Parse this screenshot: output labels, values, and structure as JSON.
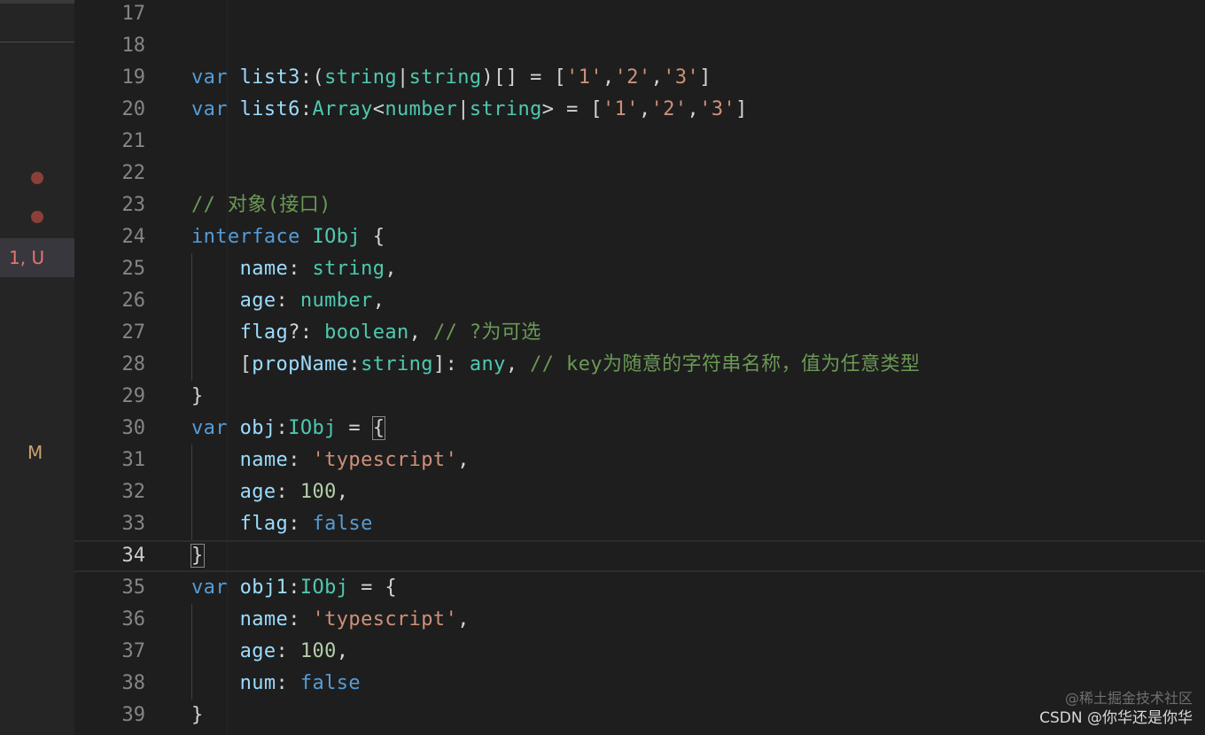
{
  "sidebar": {
    "status_error": "1, U",
    "status_modified": "M",
    "colors": {
      "error": "#e8736b",
      "modified": "#c9a26d",
      "dot": "#8a4038"
    }
  },
  "editor": {
    "lines": [
      {
        "n": "17",
        "tokens": []
      },
      {
        "n": "18",
        "tokens": []
      },
      {
        "n": "19",
        "tokens": [
          [
            "kw",
            "var"
          ],
          [
            "pun",
            " "
          ],
          [
            "var",
            "list3"
          ],
          [
            "pun",
            ":("
          ],
          [
            "type",
            "string"
          ],
          [
            "pun",
            "|"
          ],
          [
            "type",
            "string"
          ],
          [
            "pun",
            ")[] = ["
          ],
          [
            "str",
            "'1'"
          ],
          [
            "pun",
            ","
          ],
          [
            "str",
            "'2'"
          ],
          [
            "pun",
            ","
          ],
          [
            "str",
            "'3'"
          ],
          [
            "pun",
            "]"
          ]
        ]
      },
      {
        "n": "20",
        "tokens": [
          [
            "kw",
            "var"
          ],
          [
            "pun",
            " "
          ],
          [
            "var",
            "list6"
          ],
          [
            "pun",
            ":"
          ],
          [
            "type",
            "Array"
          ],
          [
            "pun",
            "<"
          ],
          [
            "type",
            "number"
          ],
          [
            "pun",
            "|"
          ],
          [
            "type",
            "string"
          ],
          [
            "pun",
            "> = ["
          ],
          [
            "str",
            "'1'"
          ],
          [
            "pun",
            ","
          ],
          [
            "str",
            "'2'"
          ],
          [
            "pun",
            ","
          ],
          [
            "str",
            "'3'"
          ],
          [
            "pun",
            "]"
          ]
        ]
      },
      {
        "n": "21",
        "tokens": []
      },
      {
        "n": "22",
        "tokens": []
      },
      {
        "n": "23",
        "tokens": [
          [
            "com",
            "// 对象(接口)"
          ]
        ]
      },
      {
        "n": "24",
        "tokens": [
          [
            "kw",
            "interface"
          ],
          [
            "pun",
            " "
          ],
          [
            "type",
            "IObj"
          ],
          [
            "pun",
            " {"
          ]
        ]
      },
      {
        "n": "25",
        "tokens": [
          [
            "pun",
            "    "
          ],
          [
            "prop",
            "name"
          ],
          [
            "pun",
            ": "
          ],
          [
            "type",
            "string"
          ],
          [
            "pun",
            ","
          ]
        ]
      },
      {
        "n": "26",
        "tokens": [
          [
            "pun",
            "    "
          ],
          [
            "prop",
            "age"
          ],
          [
            "pun",
            ": "
          ],
          [
            "type",
            "number"
          ],
          [
            "pun",
            ","
          ]
        ]
      },
      {
        "n": "27",
        "tokens": [
          [
            "pun",
            "    "
          ],
          [
            "prop",
            "flag"
          ],
          [
            "pun",
            "?: "
          ],
          [
            "type",
            "boolean"
          ],
          [
            "pun",
            ", "
          ],
          [
            "com",
            "// ?为可选"
          ]
        ]
      },
      {
        "n": "28",
        "tokens": [
          [
            "pun",
            "    ["
          ],
          [
            "prop",
            "propName"
          ],
          [
            "pun",
            ":"
          ],
          [
            "type",
            "string"
          ],
          [
            "pun",
            "]: "
          ],
          [
            "type",
            "any"
          ],
          [
            "pun",
            ", "
          ],
          [
            "com",
            "// key为随意的字符串名称，值为任意类型"
          ]
        ]
      },
      {
        "n": "29",
        "tokens": [
          [
            "pun",
            "}"
          ]
        ]
      },
      {
        "n": "30",
        "tokens": [
          [
            "kw",
            "var"
          ],
          [
            "pun",
            " "
          ],
          [
            "var",
            "obj"
          ],
          [
            "pun",
            ":"
          ],
          [
            "type",
            "IObj"
          ],
          [
            "pun",
            " = "
          ],
          [
            "bm",
            "{"
          ]
        ]
      },
      {
        "n": "31",
        "tokens": [
          [
            "pun",
            "    "
          ],
          [
            "prop",
            "name"
          ],
          [
            "pun",
            ": "
          ],
          [
            "str",
            "'typescript'"
          ],
          [
            "pun",
            ","
          ]
        ]
      },
      {
        "n": "32",
        "tokens": [
          [
            "pun",
            "    "
          ],
          [
            "prop",
            "age"
          ],
          [
            "pun",
            ": "
          ],
          [
            "num",
            "100"
          ],
          [
            "pun",
            ","
          ]
        ]
      },
      {
        "n": "33",
        "tokens": [
          [
            "pun",
            "    "
          ],
          [
            "prop",
            "flag"
          ],
          [
            "pun",
            ": "
          ],
          [
            "kw",
            "false"
          ]
        ]
      },
      {
        "n": "34",
        "tokens": [
          [
            "bm",
            "}"
          ]
        ]
      },
      {
        "n": "35",
        "tokens": [
          [
            "kw",
            "var"
          ],
          [
            "pun",
            " "
          ],
          [
            "var",
            "obj1"
          ],
          [
            "pun",
            ":"
          ],
          [
            "type",
            "IObj"
          ],
          [
            "pun",
            " = {"
          ]
        ]
      },
      {
        "n": "36",
        "tokens": [
          [
            "pun",
            "    "
          ],
          [
            "prop",
            "name"
          ],
          [
            "pun",
            ": "
          ],
          [
            "str",
            "'typescript'"
          ],
          [
            "pun",
            ","
          ]
        ]
      },
      {
        "n": "37",
        "tokens": [
          [
            "pun",
            "    "
          ],
          [
            "prop",
            "age"
          ],
          [
            "pun",
            ": "
          ],
          [
            "num",
            "100"
          ],
          [
            "pun",
            ","
          ]
        ]
      },
      {
        "n": "38",
        "tokens": [
          [
            "pun",
            "    "
          ],
          [
            "prop",
            "num"
          ],
          [
            "pun",
            ": "
          ],
          [
            "kw",
            "false"
          ]
        ]
      },
      {
        "n": "39",
        "tokens": [
          [
            "pun",
            "}"
          ]
        ]
      }
    ],
    "current_line": "34"
  },
  "watermark": {
    "line1": "@稀土掘金技术社区",
    "line2": "CSDN @你华还是你华"
  }
}
